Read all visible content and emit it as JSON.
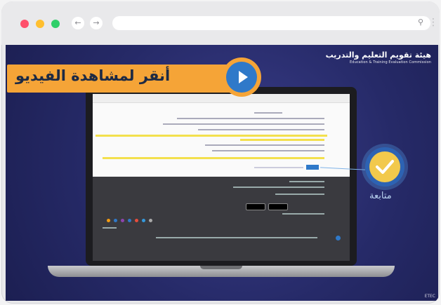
{
  "window": {
    "traffic_lights": [
      "#ff4f6b",
      "#ffbf2f",
      "#2fcf69"
    ],
    "nav": {
      "back_icon": "arrow-left-icon",
      "forward_icon": "arrow-right-icon"
    },
    "url_bar": {
      "value": "",
      "search_icon": "search-icon"
    }
  },
  "video": {
    "logo": {
      "arabic": "هيئة تقويم التعليم والتدريب",
      "english": "Education & Training Evaluation Commission"
    },
    "cta": {
      "label": "أنقر لمشاهدة الفيديو",
      "play_icon": "play-icon"
    },
    "callout": {
      "label": "متابعة",
      "icon": "checkmark-icon"
    },
    "corner_badge": "ETEC"
  },
  "colors": {
    "accent_orange": "#f5a437",
    "play_blue": "#2f79c9",
    "check_yellow": "#f2c94c"
  }
}
